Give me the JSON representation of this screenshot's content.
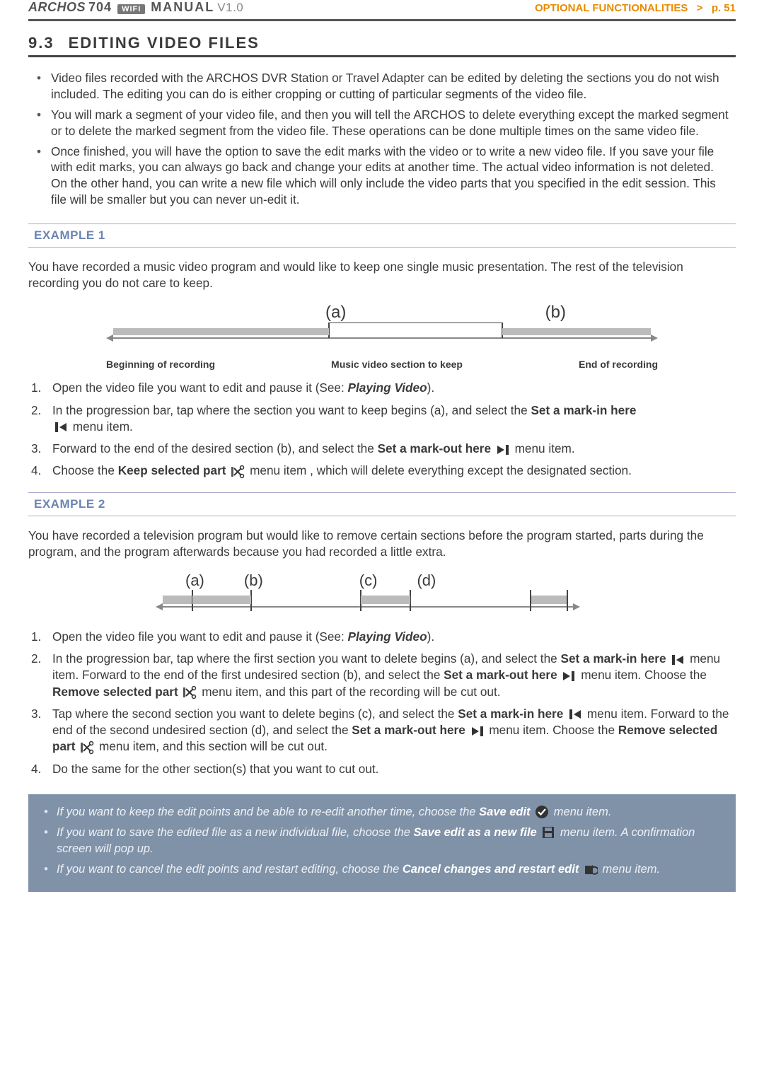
{
  "header": {
    "brand": "ARCHOS",
    "model": "704",
    "wifi_badge": "WIFI",
    "manual_word": "MANUAL",
    "version": "V1.0",
    "section_label": "OPTIONAL FUNCTIONALITIES",
    "page_label": "p. 51"
  },
  "title": {
    "number": "9.3",
    "text": "EDITING VIDEO FILES"
  },
  "intro_bullets": [
    "Video files recorded with the ARCHOS DVR Station or Travel Adapter can be edited by deleting the sections you do not wish included. The editing you can do is either cropping or cutting of particular segments of the video file.",
    "You will mark a segment of your video file, and then you will tell the ARCHOS to delete everything except the marked segment or to delete the marked segment from the video file. These operations can be done multiple times on the same video file.",
    "Once finished, you will have the option to save the edit marks with the video or to write a new video file. If you save your file with edit marks, you can always go back and change your edits at another time. The actual video information is not deleted. On the other hand, you can write a new file which will only include the video parts that you specified in the edit session. This file will be smaller but you can never un-edit it."
  ],
  "example1": {
    "label": "EXAMPLE 1",
    "intro": "You have recorded a music video program and would like to keep one single music presentation.  The rest of the television recording you do not care to keep.",
    "diagram": {
      "label_a": "(a)",
      "label_b": "(b)",
      "cap_begin": "Beginning of recording",
      "cap_mid": "Music video section to keep",
      "cap_end": "End of recording"
    },
    "steps": {
      "s1_pre": "Open the video file you want to edit and pause it (See: ",
      "s1_link": "Playing Video",
      "s1_post": ").",
      "s2_pre": "In the progression bar, tap where the section you want to keep begins (a), and select the ",
      "s2_bold": "Set a mark-in here",
      "s2_post": " menu item.",
      "s3_pre": "Forward to the end of the desired section (b), and select the ",
      "s3_bold": "Set a mark-out here",
      "s3_post": " menu item.",
      "s4_pre": "Choose the ",
      "s4_bold": "Keep selected part",
      "s4_post": " menu item , which will delete everything except the designated section."
    }
  },
  "example2": {
    "label": "EXAMPLE 2",
    "intro": "You have recorded a television program but would like to remove certain sections before the program started, parts during the program, and the program afterwards because you had recorded a little extra.",
    "diagram": {
      "a": "(a)",
      "b": "(b)",
      "c": "(c)",
      "d": "(d)"
    },
    "steps": {
      "s1_pre": "Open the video file you want to edit and pause it (See: ",
      "s1_link": "Playing Video",
      "s1_post": ").",
      "s2_pre": "In the progression bar, tap where the first section you want to delete begins (a), and select the ",
      "s2_b1": "Set a mark-in here",
      "s2_mid1": " menu item. Forward to the end of the first undesired section (b), and select the ",
      "s2_b2": "Set a mark-out here",
      "s2_mid2": " menu item. Choose the ",
      "s2_b3": "Remove selected part",
      "s2_post": " menu item, and this part of the recording will be cut out.",
      "s3_pre": "Tap where the second section you want to delete begins (c), and select the ",
      "s3_b1": "Set a mark-in here",
      "s3_mid1": " menu item. Forward to the end of the second undesired section (d), and select the ",
      "s3_b2": "Set a mark-out here",
      "s3_mid2": " menu item. Choose the ",
      "s3_b3": "Remove selected part",
      "s3_post": " menu item, and this section will be cut out.",
      "s4": "Do the same for the other section(s) that you want to cut out."
    }
  },
  "notes": {
    "n1_pre": "If you want to keep the edit points and be able to re-edit another time, choose the ",
    "n1_bold": "Save edit",
    "n1_post": " menu item.",
    "n2_pre": "If you want to save the edited file as a new individual file, choose the ",
    "n2_bold": "Save edit as a new file",
    "n2_post": " menu item. A confirmation screen will pop up.",
    "n3_pre": "If you want to cancel the edit points and restart editing, choose the ",
    "n3_bold": "Cancel changes and restart edit",
    "n3_post": " menu item."
  }
}
